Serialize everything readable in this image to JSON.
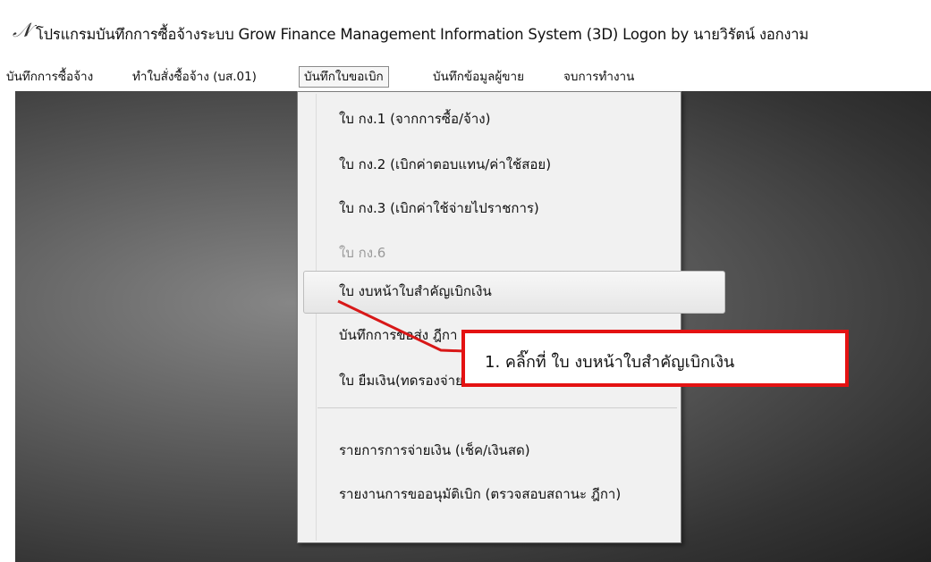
{
  "window": {
    "icon_glyph": "𝒩",
    "title": "โปรแกรมบันทึกการซื้อจ้างระบบ  Grow Finance Management Information System (3D) Logon by นายวิรัตน์  งอกงาม"
  },
  "menubar": {
    "items": [
      {
        "label": "บันทึกการซื้อจ้าง"
      },
      {
        "label": "ทำใบสั่งซื้อจ้าง (บส.01)"
      },
      {
        "label": "บันทึกใบขอเบิก"
      },
      {
        "label": "บันทึกข้อมูลผู้ขาย"
      },
      {
        "label": "จบการทำงาน"
      }
    ],
    "active_index": 2
  },
  "dropdown": {
    "items": [
      {
        "label": "ใบ กง.1 (จากการซื้อ/จ้าง)",
        "enabled": true
      },
      {
        "label": "ใบ กง.2 (เบิกค่าตอบแทน/ค่าใช้สอย)",
        "enabled": true
      },
      {
        "label": "ใบ กง.3 (เบิกค่าใช้จ่ายไปราชการ)",
        "enabled": true
      },
      {
        "label": "ใบ กง.6",
        "enabled": false
      },
      {
        "label": "ใบ งบหน้าใบสำคัญเบิกเงิน",
        "enabled": true,
        "highlighted": true
      },
      {
        "label": "บันทึกการขอส่ง ฎีกา",
        "enabled": true
      },
      {
        "label": "ใบ ยืมเงิน(ทดรองจ่าย)",
        "enabled": true
      },
      {
        "label": "รายการการจ่ายเงิน (เช็ค/เงินสด)",
        "enabled": true
      },
      {
        "label": "รายงานการขออนุมัติเบิก (ตรวจสอบสถานะ ฎีกา)",
        "enabled": true
      }
    ]
  },
  "callout": {
    "text": "1. คลิ๊กที่ ใบ งบหน้าใบสำคัญเบิกเงิน",
    "border_color": "#e41212",
    "arrow_color": "#d81818"
  },
  "colors": {
    "workspace": "#5c5c5c",
    "menu_background": "#f1f1f1",
    "disabled_text": "#9a9a9a"
  }
}
